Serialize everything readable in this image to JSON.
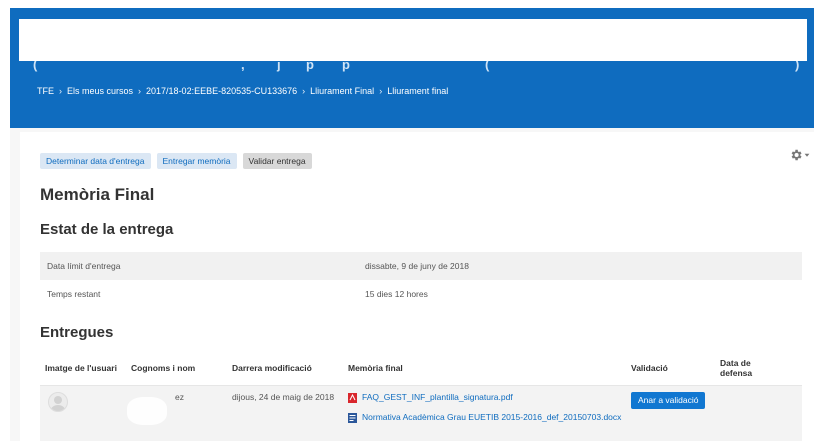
{
  "breadcrumb": [
    "TFE",
    "Els meus cursos",
    "2017/18-02:EEBE-820535-CU133676",
    "Lliurament Final",
    "Lliurament final"
  ],
  "tabs": [
    {
      "label": "Determinar data d'entrega",
      "active": false
    },
    {
      "label": "Entregar memòria",
      "active": false
    },
    {
      "label": "Validar entrega",
      "active": true
    }
  ],
  "page_title": "Memòria Final",
  "status_section": {
    "title": "Estat de la entrega",
    "rows": [
      {
        "label": "Data límit d'entrega",
        "value": "dissabte, 9 de juny de 2018"
      },
      {
        "label": "Temps restant",
        "value": "15 dies 12 hores"
      }
    ]
  },
  "submissions": {
    "title": "Entregues",
    "headers": [
      "Imatge de l'usuari",
      "Cognoms i nom",
      "Darrera modificació",
      "Memòria final",
      "Validació",
      "Data de defensa"
    ],
    "row": {
      "name": "ez",
      "modified": "dijous, 24 de maig de 2018",
      "files": [
        {
          "name": "FAQ_GEST_INF_plantilla_signatura.pdf",
          "icon": "pdf-icon"
        },
        {
          "name": "Normativa Acadèmica Grau EUETIB 2015-2016_def_20150703.docx",
          "icon": "word-doc-icon"
        }
      ],
      "validate_label": "Anar a validació"
    }
  },
  "colors": {
    "header": "#0f6cbf",
    "link": "#0f6cbf",
    "button": "#1177d1"
  }
}
